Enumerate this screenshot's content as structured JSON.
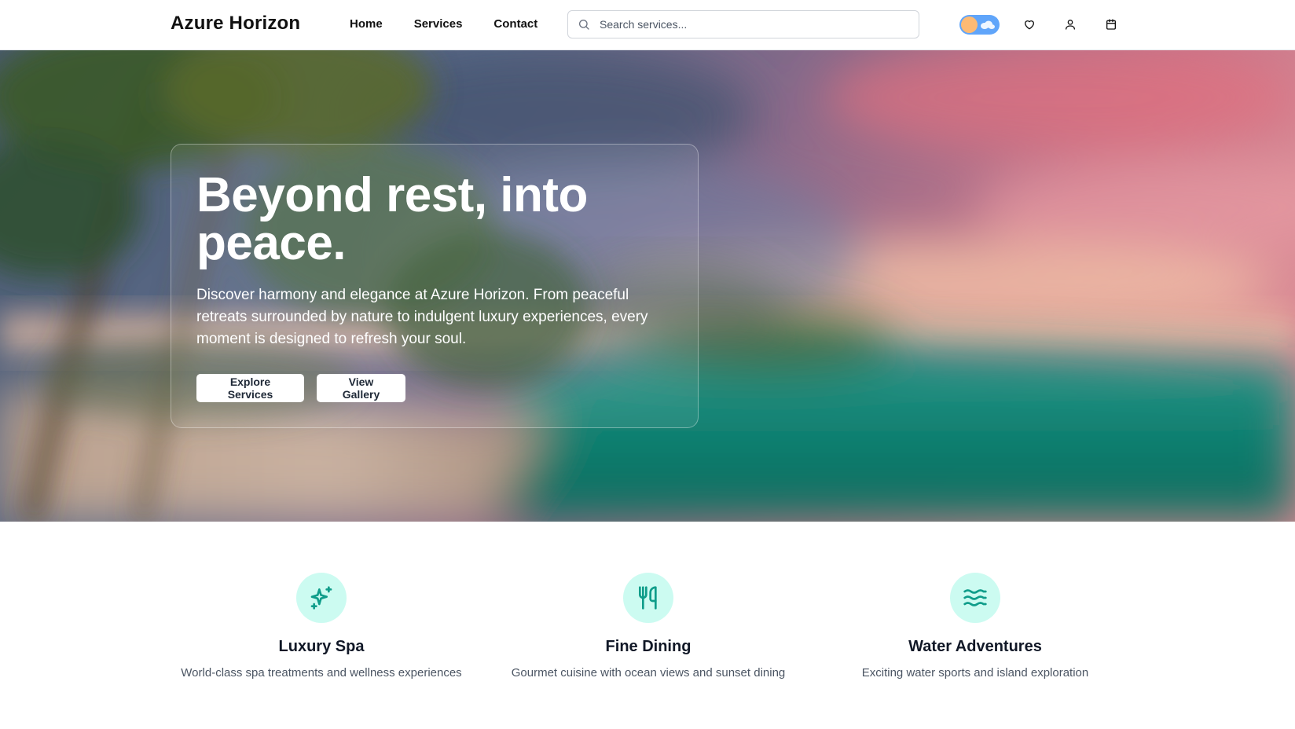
{
  "header": {
    "brand": "Azure Horizon",
    "nav": [
      "Home",
      "Services",
      "Contact"
    ],
    "search_placeholder": "Search services...",
    "icons": [
      "theme-toggle",
      "heart-icon",
      "user-icon",
      "calendar-icon"
    ]
  },
  "hero": {
    "title": "Beyond rest, into peace.",
    "text": "Discover harmony and elegance at Azure Horizon. From peaceful retreats surrounded by nature to indulgent luxury experiences, every moment is designed to refresh your soul.",
    "buttons": {
      "explore": "Explore Services",
      "gallery": "View Gallery"
    }
  },
  "features": [
    {
      "icon": "sparkles-icon",
      "title": "Luxury Spa",
      "desc": "World-class spa treatments and wellness experiences"
    },
    {
      "icon": "utensils-icon",
      "title": "Fine Dining",
      "desc": "Gourmet cuisine with ocean views and sunset dining"
    },
    {
      "icon": "waves-icon",
      "title": "Water Adventures",
      "desc": "Exciting water sports and island exploration"
    }
  ],
  "colors": {
    "accent": "#0f9d8a",
    "icon_bg": "#ccfbf1",
    "toggle": "#60a5fa"
  }
}
